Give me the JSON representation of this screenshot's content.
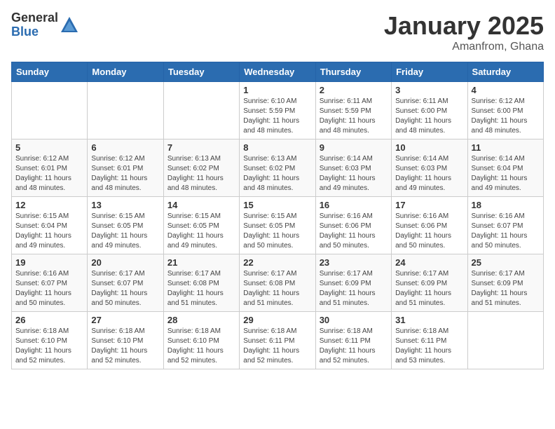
{
  "logo": {
    "general": "General",
    "blue": "Blue"
  },
  "header": {
    "month": "January 2025",
    "location": "Amanfrom, Ghana"
  },
  "weekdays": [
    "Sunday",
    "Monday",
    "Tuesday",
    "Wednesday",
    "Thursday",
    "Friday",
    "Saturday"
  ],
  "weeks": [
    [
      {
        "day": "",
        "sunrise": "",
        "sunset": "",
        "daylight": ""
      },
      {
        "day": "",
        "sunrise": "",
        "sunset": "",
        "daylight": ""
      },
      {
        "day": "",
        "sunrise": "",
        "sunset": "",
        "daylight": ""
      },
      {
        "day": "1",
        "sunrise": "Sunrise: 6:10 AM",
        "sunset": "Sunset: 5:59 PM",
        "daylight": "Daylight: 11 hours and 48 minutes."
      },
      {
        "day": "2",
        "sunrise": "Sunrise: 6:11 AM",
        "sunset": "Sunset: 5:59 PM",
        "daylight": "Daylight: 11 hours and 48 minutes."
      },
      {
        "day": "3",
        "sunrise": "Sunrise: 6:11 AM",
        "sunset": "Sunset: 6:00 PM",
        "daylight": "Daylight: 11 hours and 48 minutes."
      },
      {
        "day": "4",
        "sunrise": "Sunrise: 6:12 AM",
        "sunset": "Sunset: 6:00 PM",
        "daylight": "Daylight: 11 hours and 48 minutes."
      }
    ],
    [
      {
        "day": "5",
        "sunrise": "Sunrise: 6:12 AM",
        "sunset": "Sunset: 6:01 PM",
        "daylight": "Daylight: 11 hours and 48 minutes."
      },
      {
        "day": "6",
        "sunrise": "Sunrise: 6:12 AM",
        "sunset": "Sunset: 6:01 PM",
        "daylight": "Daylight: 11 hours and 48 minutes."
      },
      {
        "day": "7",
        "sunrise": "Sunrise: 6:13 AM",
        "sunset": "Sunset: 6:02 PM",
        "daylight": "Daylight: 11 hours and 48 minutes."
      },
      {
        "day": "8",
        "sunrise": "Sunrise: 6:13 AM",
        "sunset": "Sunset: 6:02 PM",
        "daylight": "Daylight: 11 hours and 48 minutes."
      },
      {
        "day": "9",
        "sunrise": "Sunrise: 6:14 AM",
        "sunset": "Sunset: 6:03 PM",
        "daylight": "Daylight: 11 hours and 49 minutes."
      },
      {
        "day": "10",
        "sunrise": "Sunrise: 6:14 AM",
        "sunset": "Sunset: 6:03 PM",
        "daylight": "Daylight: 11 hours and 49 minutes."
      },
      {
        "day": "11",
        "sunrise": "Sunrise: 6:14 AM",
        "sunset": "Sunset: 6:04 PM",
        "daylight": "Daylight: 11 hours and 49 minutes."
      }
    ],
    [
      {
        "day": "12",
        "sunrise": "Sunrise: 6:15 AM",
        "sunset": "Sunset: 6:04 PM",
        "daylight": "Daylight: 11 hours and 49 minutes."
      },
      {
        "day": "13",
        "sunrise": "Sunrise: 6:15 AM",
        "sunset": "Sunset: 6:05 PM",
        "daylight": "Daylight: 11 hours and 49 minutes."
      },
      {
        "day": "14",
        "sunrise": "Sunrise: 6:15 AM",
        "sunset": "Sunset: 6:05 PM",
        "daylight": "Daylight: 11 hours and 49 minutes."
      },
      {
        "day": "15",
        "sunrise": "Sunrise: 6:15 AM",
        "sunset": "Sunset: 6:05 PM",
        "daylight": "Daylight: 11 hours and 50 minutes."
      },
      {
        "day": "16",
        "sunrise": "Sunrise: 6:16 AM",
        "sunset": "Sunset: 6:06 PM",
        "daylight": "Daylight: 11 hours and 50 minutes."
      },
      {
        "day": "17",
        "sunrise": "Sunrise: 6:16 AM",
        "sunset": "Sunset: 6:06 PM",
        "daylight": "Daylight: 11 hours and 50 minutes."
      },
      {
        "day": "18",
        "sunrise": "Sunrise: 6:16 AM",
        "sunset": "Sunset: 6:07 PM",
        "daylight": "Daylight: 11 hours and 50 minutes."
      }
    ],
    [
      {
        "day": "19",
        "sunrise": "Sunrise: 6:16 AM",
        "sunset": "Sunset: 6:07 PM",
        "daylight": "Daylight: 11 hours and 50 minutes."
      },
      {
        "day": "20",
        "sunrise": "Sunrise: 6:17 AM",
        "sunset": "Sunset: 6:07 PM",
        "daylight": "Daylight: 11 hours and 50 minutes."
      },
      {
        "day": "21",
        "sunrise": "Sunrise: 6:17 AM",
        "sunset": "Sunset: 6:08 PM",
        "daylight": "Daylight: 11 hours and 51 minutes."
      },
      {
        "day": "22",
        "sunrise": "Sunrise: 6:17 AM",
        "sunset": "Sunset: 6:08 PM",
        "daylight": "Daylight: 11 hours and 51 minutes."
      },
      {
        "day": "23",
        "sunrise": "Sunrise: 6:17 AM",
        "sunset": "Sunset: 6:09 PM",
        "daylight": "Daylight: 11 hours and 51 minutes."
      },
      {
        "day": "24",
        "sunrise": "Sunrise: 6:17 AM",
        "sunset": "Sunset: 6:09 PM",
        "daylight": "Daylight: 11 hours and 51 minutes."
      },
      {
        "day": "25",
        "sunrise": "Sunrise: 6:17 AM",
        "sunset": "Sunset: 6:09 PM",
        "daylight": "Daylight: 11 hours and 51 minutes."
      }
    ],
    [
      {
        "day": "26",
        "sunrise": "Sunrise: 6:18 AM",
        "sunset": "Sunset: 6:10 PM",
        "daylight": "Daylight: 11 hours and 52 minutes."
      },
      {
        "day": "27",
        "sunrise": "Sunrise: 6:18 AM",
        "sunset": "Sunset: 6:10 PM",
        "daylight": "Daylight: 11 hours and 52 minutes."
      },
      {
        "day": "28",
        "sunrise": "Sunrise: 6:18 AM",
        "sunset": "Sunset: 6:10 PM",
        "daylight": "Daylight: 11 hours and 52 minutes."
      },
      {
        "day": "29",
        "sunrise": "Sunrise: 6:18 AM",
        "sunset": "Sunset: 6:11 PM",
        "daylight": "Daylight: 11 hours and 52 minutes."
      },
      {
        "day": "30",
        "sunrise": "Sunrise: 6:18 AM",
        "sunset": "Sunset: 6:11 PM",
        "daylight": "Daylight: 11 hours and 52 minutes."
      },
      {
        "day": "31",
        "sunrise": "Sunrise: 6:18 AM",
        "sunset": "Sunset: 6:11 PM",
        "daylight": "Daylight: 11 hours and 53 minutes."
      },
      {
        "day": "",
        "sunrise": "",
        "sunset": "",
        "daylight": ""
      }
    ]
  ]
}
